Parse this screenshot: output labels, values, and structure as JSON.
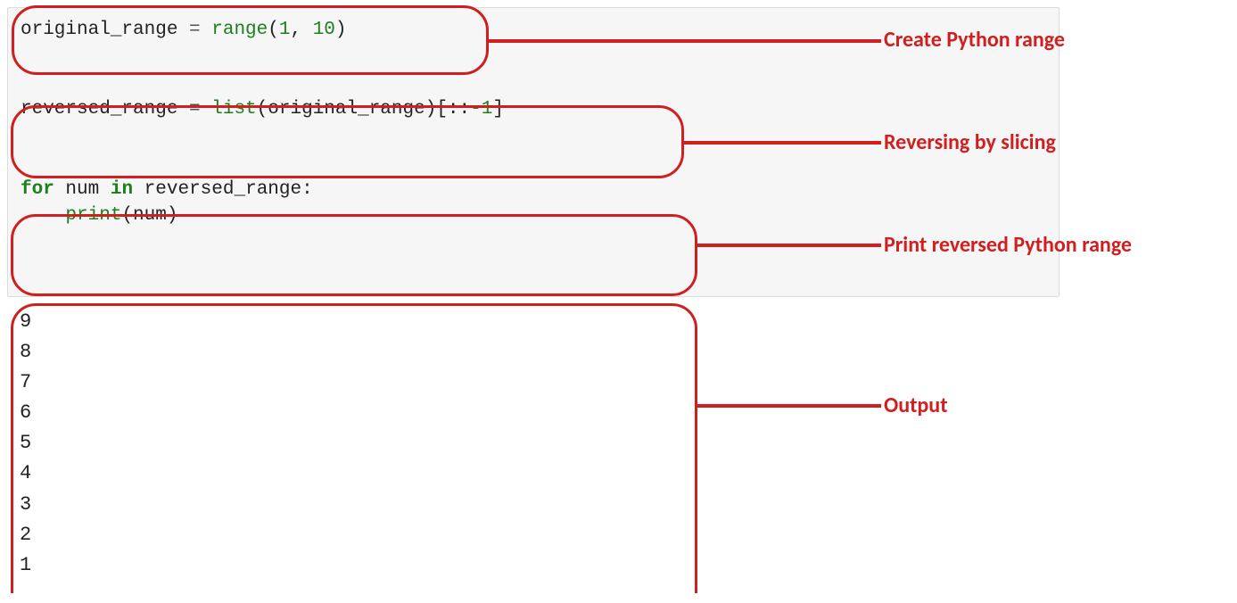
{
  "code": {
    "line1": {
      "var": "original_range ",
      "eq": "= ",
      "fn": "range",
      "open": "(",
      "arg1": "1",
      "comma": ", ",
      "arg2": "10",
      "close": ")"
    },
    "line2": {
      "var": "reversed_range ",
      "eq": "= ",
      "fn": "list",
      "open": "(",
      "arg": "original_range",
      "close": ")[::",
      "neg": "-1",
      "end": "]"
    },
    "line3": {
      "for": "for",
      "space1": " ",
      "var": "num ",
      "in": "in",
      "space2": " ",
      "iter": "reversed_range:"
    },
    "line4": {
      "indent": "    ",
      "fn": "print",
      "open": "(",
      "arg": "num",
      "close": ")"
    }
  },
  "output": [
    "9",
    "8",
    "7",
    "6",
    "5",
    "4",
    "3",
    "2",
    "1"
  ],
  "annotations": {
    "a1": "Create Python range",
    "a2": "Reversing by slicing",
    "a3": "Print reversed Python range",
    "a4": "Output"
  }
}
